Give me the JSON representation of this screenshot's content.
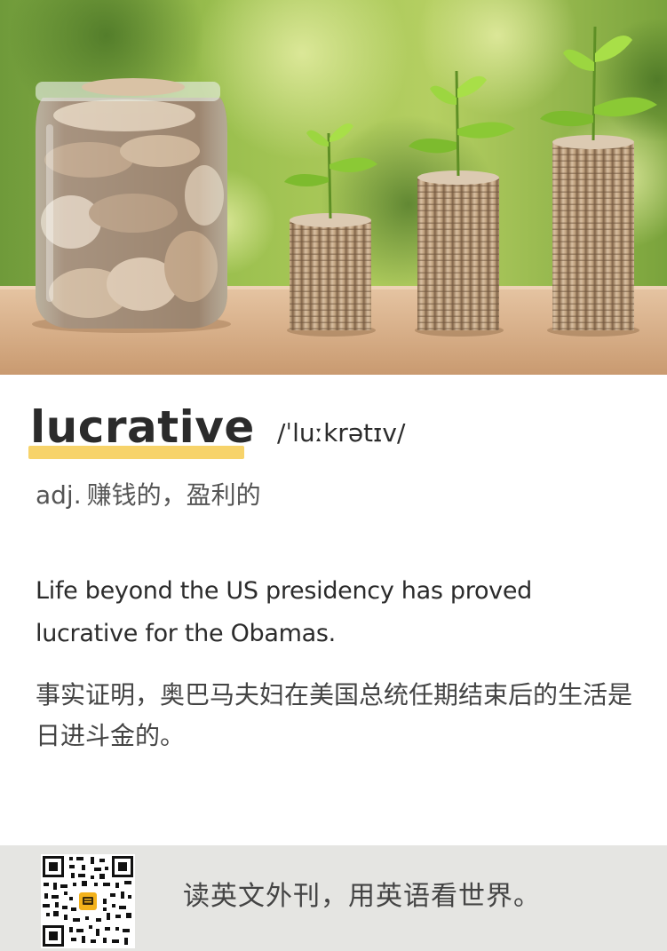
{
  "card": {
    "hero_image": "coins-jar-and-seedling-stacks",
    "word": "lucrative",
    "phonetic": "/ˈluːkrətɪv/",
    "part_of_speech": "adj.",
    "definition_zh": "赚钱的，盈利的",
    "example_en": "Life beyond the US presidency has proved lucrative for the Obamas.",
    "example_zh": "事实证明，奥巴马夫妇在美国总统任期结束后的生活是日进斗金的。",
    "highlight_color": "#f7d36a"
  },
  "footer": {
    "qr_code": "qr-code",
    "slogan": "读英文外刊，用英语看世界。",
    "background": "#e5e5e2"
  }
}
